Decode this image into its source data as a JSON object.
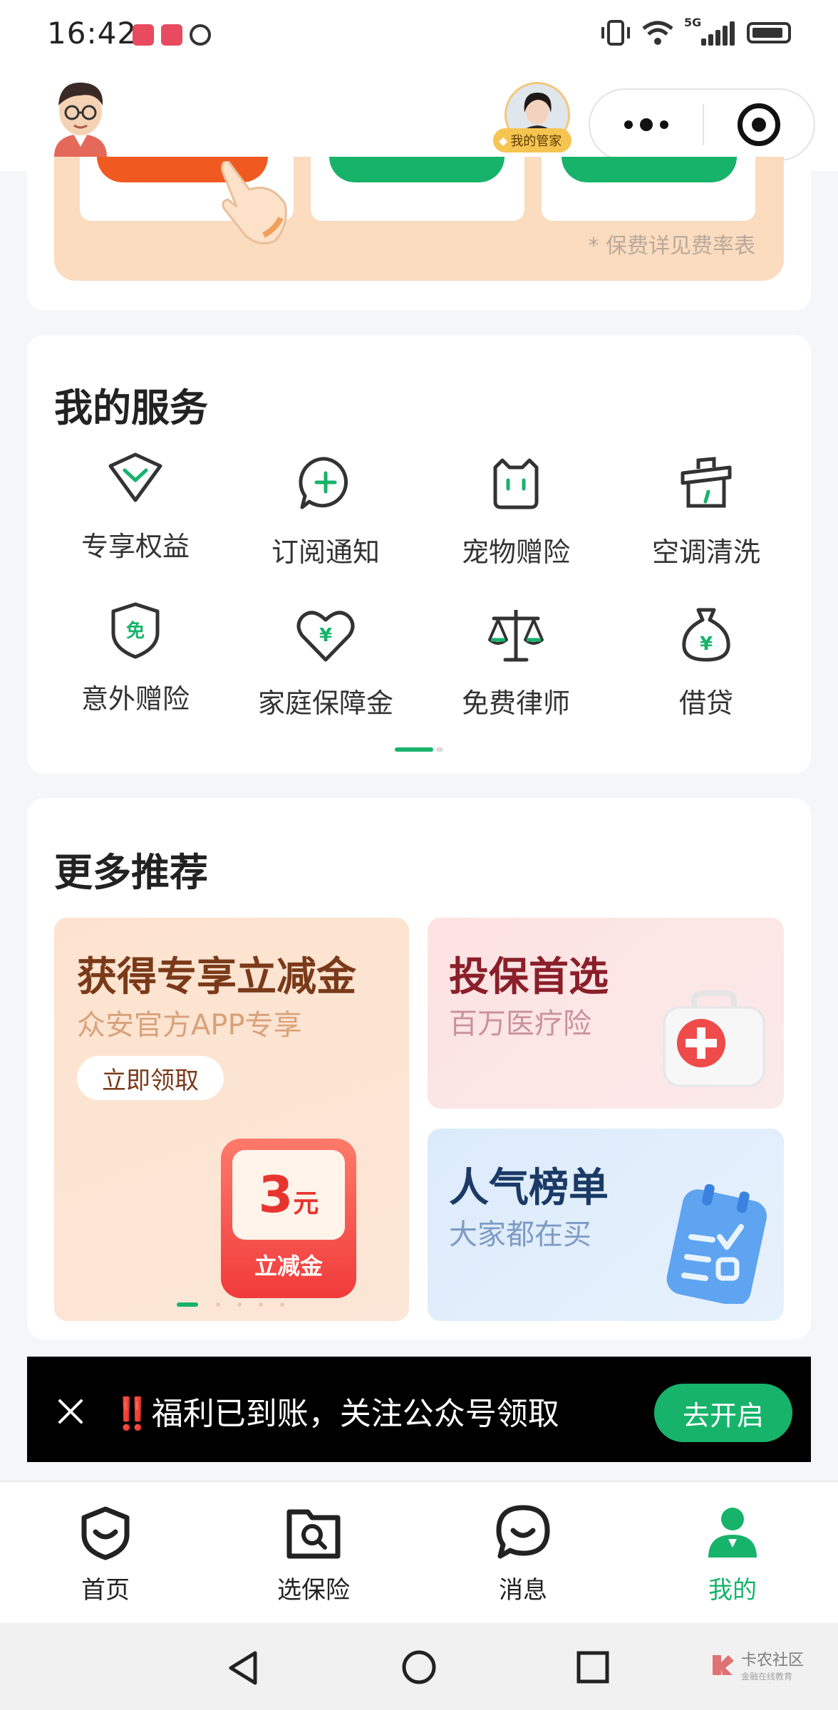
{
  "status_bar": {
    "time": "16:42",
    "network": "5G"
  },
  "header": {
    "butler_label": "我的管家"
  },
  "promo": {
    "fee_note": "* 保费详见费率表"
  },
  "services": {
    "title": "我的服务",
    "items": [
      {
        "label": "专享权益",
        "icon": "diamond-icon"
      },
      {
        "label": "订阅通知",
        "icon": "plus-bubble-icon"
      },
      {
        "label": "宠物赠险",
        "icon": "pet-icon"
      },
      {
        "label": "空调清洗",
        "icon": "ac-clean-icon"
      },
      {
        "label": "意外赠险",
        "icon": "shield-free-icon",
        "badge": "免"
      },
      {
        "label": "家庭保障金",
        "icon": "heart-yen-icon",
        "badge": "¥"
      },
      {
        "label": "免费律师",
        "icon": "scale-icon"
      },
      {
        "label": "借贷",
        "icon": "money-bag-icon",
        "badge": "¥"
      }
    ]
  },
  "recommend": {
    "title": "更多推荐",
    "banner": {
      "title": "获得专享立减金",
      "subtitle": "众安官方APP专享",
      "button": "立即领取",
      "coupon_amount": "3",
      "coupon_unit": "元",
      "coupon_label": "立减金"
    },
    "card1": {
      "title": "投保首选",
      "subtitle": "百万医疗险"
    },
    "card2": {
      "title": "人气榜单",
      "subtitle": "大家都在买"
    }
  },
  "notice": {
    "text": "‼️福利已到账，关注公众号领取",
    "button": "去开启"
  },
  "tabbar": {
    "items": [
      {
        "label": "首页"
      },
      {
        "label": "选保险"
      },
      {
        "label": "消息"
      },
      {
        "label": "我的"
      }
    ],
    "active_color": "#17b36b"
  },
  "watermark": {
    "name": "卡农社区",
    "tagline": "金融在线教育"
  },
  "colors": {
    "accent": "#17b36b",
    "promo_bg": "#fbdcbf"
  }
}
